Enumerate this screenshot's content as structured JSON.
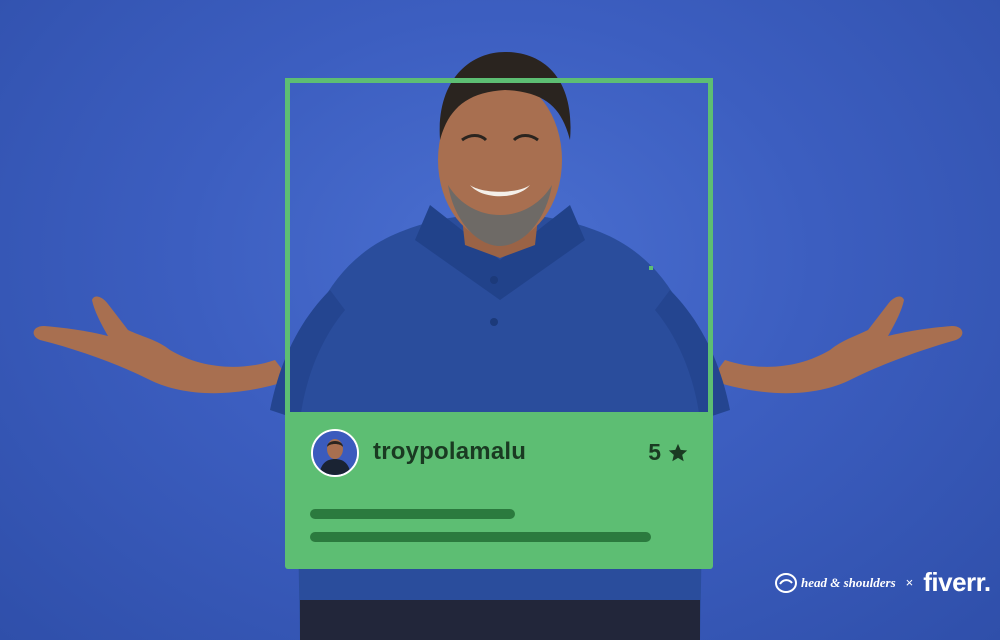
{
  "colors": {
    "background": "#3c5ec0",
    "card_green": "#5dbe73",
    "text_dark": "#1a3a22",
    "placeholder_line": "#2b7a3e",
    "shirt": "#2a4d9c"
  },
  "card": {
    "username": "troypolamalu",
    "rating": "5",
    "rating_icon": "star-icon"
  },
  "brands": {
    "brand_1": "head & shoulders",
    "separator": "×",
    "brand_2": "fiverr."
  }
}
